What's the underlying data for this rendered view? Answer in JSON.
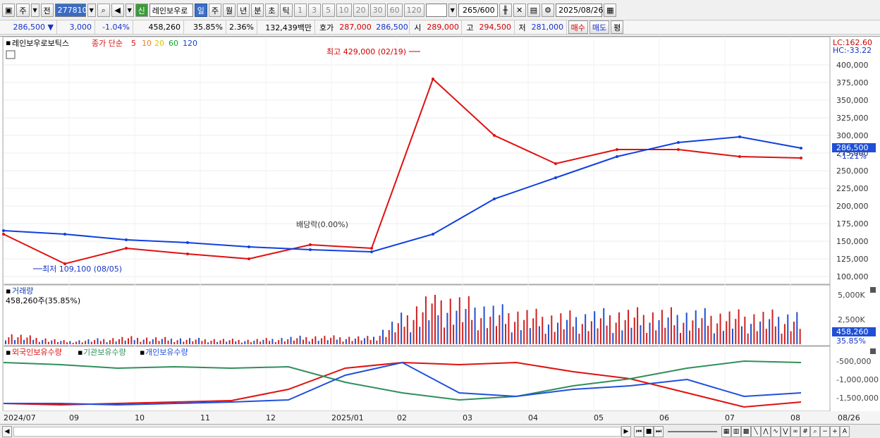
{
  "toolbar": {
    "type_label": "주",
    "all_label": "전",
    "code": "277810",
    "credit_badge": "신",
    "stock_name": "레인보우로",
    "periods": [
      "일",
      "주",
      "월",
      "년",
      "분",
      "초",
      "틱"
    ],
    "active_period": "일",
    "intervals": [
      "1",
      "3",
      "5",
      "10",
      "20",
      "30",
      "60",
      "120"
    ],
    "count_value": "265",
    "count_total": "/600",
    "date": "2025/08/26"
  },
  "quote": {
    "price": "286,500",
    "change_arrow": "▼",
    "change": "3,000",
    "change_pct": "-1.04%",
    "volume": "458,260",
    "vol_ratio": "35.85%",
    "turnover": "2.36%",
    "amount": "132,439백만",
    "hoga_label": "호가",
    "ask": "287,000",
    "bid": "286,500",
    "open_label": "시",
    "open": "289,000",
    "high_label": "고",
    "high": "294,500",
    "low_label": "저",
    "low": "281,000",
    "buy_label": "매수",
    "sell_label": "매도",
    "eval_label": "평"
  },
  "price_panel": {
    "title": "레인보우로보틱스",
    "ma_label": "종가 단순",
    "ma_periods": [
      "5",
      "10",
      "20",
      "60",
      "120"
    ],
    "ma_colors": [
      "#e01010",
      "#f08020",
      "#f0e000",
      "#10a030",
      "#1040e0"
    ],
    "high_annotation": "최고 429,000 (02/19)",
    "low_annotation": "최저 109,100 (08/05)",
    "dividend_annotation": "배당락(0.00%)",
    "lc": "LC:162.60",
    "hc": "HC:-33.22",
    "current_tag": "286,500",
    "current_pct": "-1.21%",
    "y_labels": [
      "400,000",
      "375,000",
      "350,000",
      "325,000",
      "300,000",
      "275,000",
      "250,000",
      "225,000",
      "200,000",
      "175,000",
      "150,000",
      "125,000",
      "100,000"
    ]
  },
  "volume_panel": {
    "title": "거래량",
    "value_text": "458,260주(35.85%)",
    "y_labels": [
      "5,000K",
      "2,500K"
    ],
    "current_tag": "458,260",
    "current_pct": "35.85%"
  },
  "flow_panel": {
    "series_labels": [
      "외국인보유수량",
      "기관보유수량",
      "개인보유수량"
    ],
    "series_colors": [
      "#e01010",
      "#2f8f5a",
      "#2050e0"
    ],
    "y_labels": [
      "-500,000",
      "-1,000,000",
      "-1,500,000"
    ]
  },
  "x_axis": {
    "labels": [
      "2024/07",
      "09",
      "10",
      "11",
      "12",
      "2025/01",
      "02",
      "03",
      "04",
      "05",
      "06",
      "07",
      "08",
      "08/26"
    ]
  },
  "chart_data": {
    "type": "line",
    "title": "레인보우로보틱스",
    "x": [
      "2024/07",
      "08",
      "09",
      "10",
      "11",
      "12",
      "2025/01",
      "02",
      "03",
      "04",
      "05",
      "06",
      "07",
      "08"
    ],
    "series": [
      {
        "name": "5",
        "values": [
          160000,
          118000,
          140000,
          132000,
          125000,
          145000,
          140000,
          380000,
          300000,
          260000,
          280000,
          280000,
          270000,
          268000
        ]
      },
      {
        "name": "120",
        "values": [
          165000,
          160000,
          152000,
          148000,
          142000,
          138000,
          135000,
          160000,
          210000,
          240000,
          270000,
          290000,
          298000,
          282000
        ]
      }
    ],
    "ylim": [
      90000,
      440000
    ],
    "annotations": [
      "최고 429,000 (02/19)",
      "최저 109,100 (08/05)",
      "배당락(0.00%)"
    ]
  }
}
